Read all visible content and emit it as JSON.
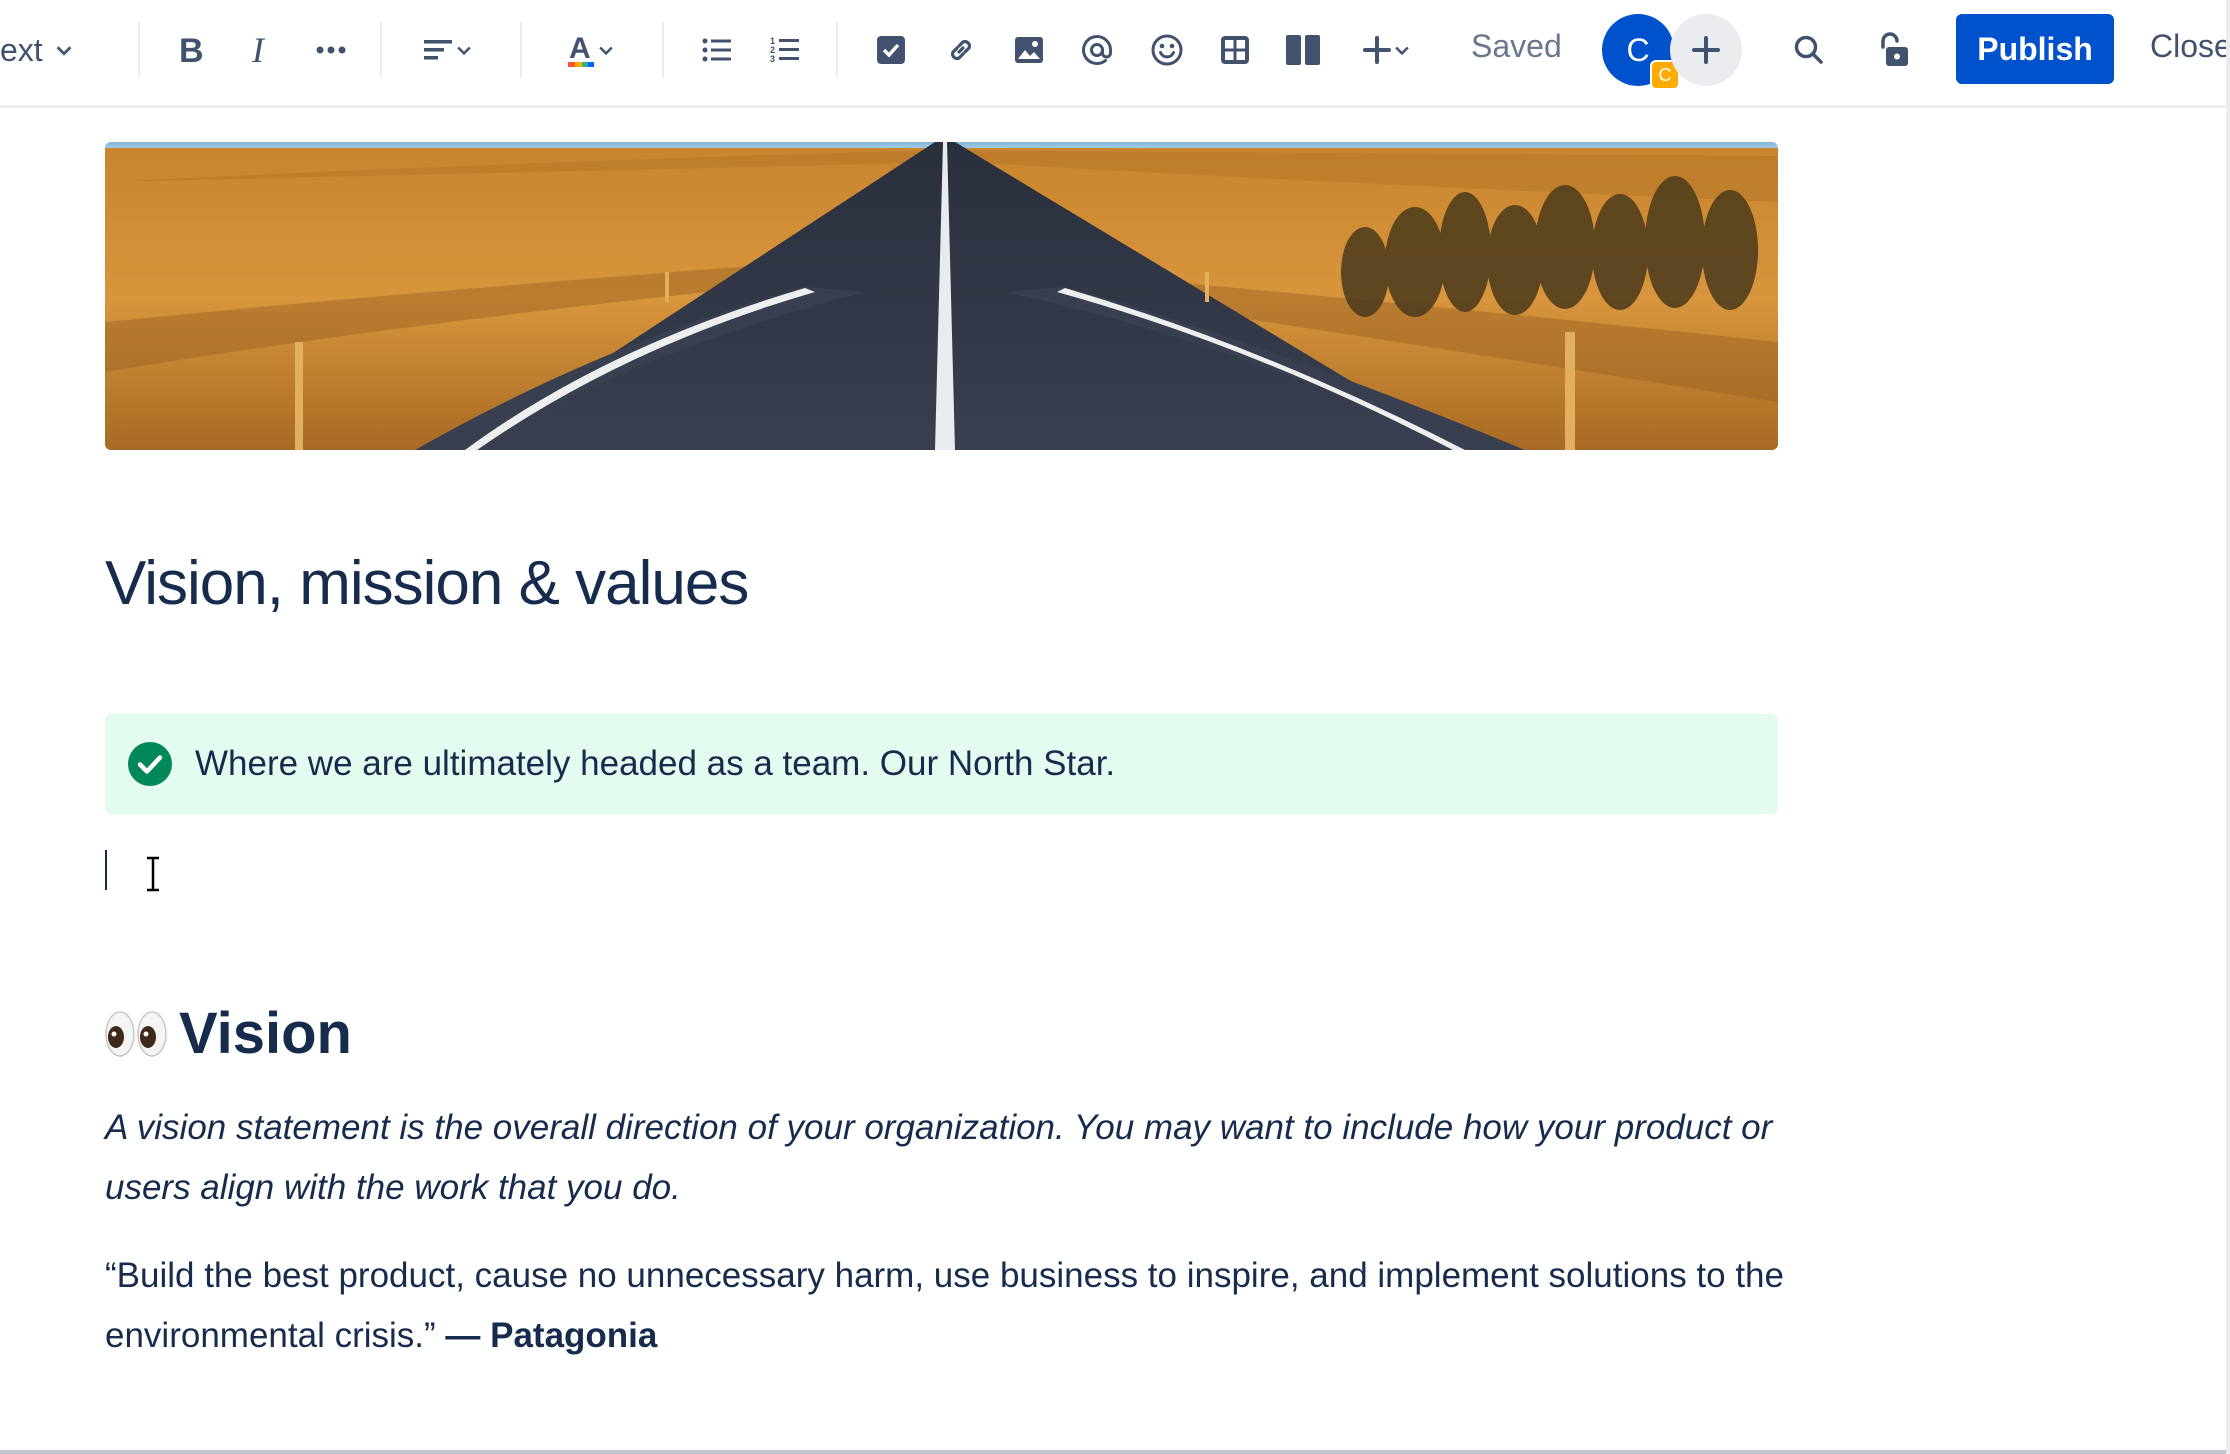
{
  "toolbar": {
    "text_style": "ext",
    "saved_label": "Saved",
    "avatar_initial": "C",
    "avatar_badge": "C",
    "publish_label": "Publish",
    "close_label": "Close"
  },
  "content": {
    "page_title": "Vision, mission & values",
    "panel_text": "Where we are ultimately headed as a team. Our North Star.",
    "vision_heading": "Vision",
    "vision_description": "A vision statement is the overall direction of your organization. You may want to include how your product or users align with the work that you do.",
    "quote_text": "“Build the best product, cause no unnecessary harm, use business to inspire, and implement solutions to the environmental crisis.”",
    "quote_author": "— Patagonia"
  },
  "colors": {
    "primary": "#0052cc",
    "text": "#172b4d",
    "panel_bg": "#e3fcef",
    "success": "#00875a",
    "badge": "#ffab00"
  }
}
